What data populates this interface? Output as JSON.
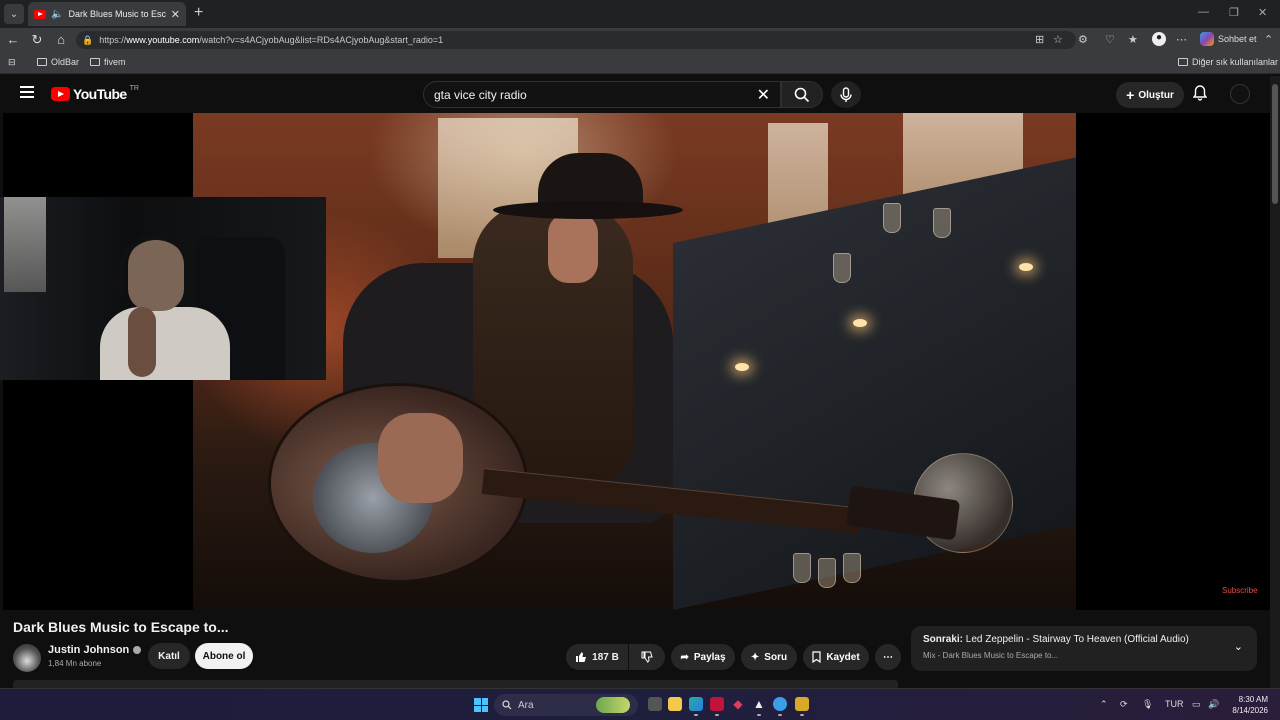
{
  "browser": {
    "tab_title": "Dark Blues Music to Escape to...",
    "url_prefix": "https://",
    "url_host": "www.youtube.com",
    "url_path": "/watch?v=s4ACjyobAug&list=RDs4ACjyobAug&start_radio=1",
    "copilot_label": "Sohbet et",
    "bookmarks": [
      "OldBar",
      "fivem"
    ],
    "other_bookmarks_label": "Diğer sık kullanılanlar"
  },
  "youtube": {
    "wordmark": "YouTube",
    "region": "TR",
    "search_value": "gta vice city radio",
    "create_label": "Oluştur"
  },
  "video": {
    "title": "Dark Blues Music to Escape to...",
    "overlay_label": "Subscribe"
  },
  "channel": {
    "name": "Justin Johnson",
    "subscribers": "1,84 Mn abone",
    "join_label": "Katıl",
    "subscribe_label": "Abone ol"
  },
  "actions": {
    "likes": "187 B",
    "share_label": "Paylaş",
    "ask_label": "Soru",
    "save_label": "Kaydet"
  },
  "next_up": {
    "prefix": "Sonraki:",
    "title": "Led Zeppelin - Stairway To Heaven (Official Audio)",
    "subtitle": "Mix - Dark Blues Music to Escape to..."
  },
  "taskbar": {
    "search_placeholder": "Ara",
    "language": "TUR",
    "time": "8:30 AM",
    "date": "8/14/2026"
  },
  "colors": {
    "youtube_red": "#ff0000",
    "background": "#0f0f0f",
    "subscribe_overlay": "#e84c4c"
  }
}
